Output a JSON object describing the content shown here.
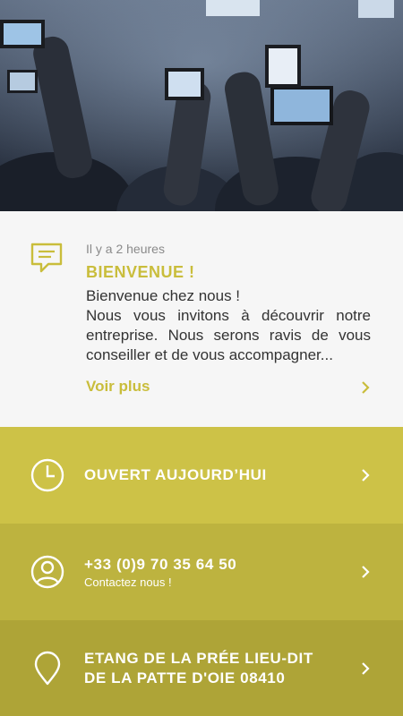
{
  "news": {
    "time": "Il y a 2 heures",
    "title": "BIENVENUE !",
    "body_line1": "Bienvenue chez nous !",
    "body_line2": "Nous vous invitons à découvrir notre entreprise. Nous serons ravis de vous conseiller et de vous accompagner...",
    "more_label": "Voir plus",
    "icon": "message-icon"
  },
  "hours": {
    "title": "OUVERT AUJOURD’HUI",
    "icon": "clock-icon"
  },
  "phone": {
    "number": "+33 (0)9 70 35 64 50",
    "sub": "Contactez nous !",
    "icon": "user-icon"
  },
  "address": {
    "line1": "ETANG DE LA PRÉE LIEU-DIT",
    "line2": "DE LA PATTE D'OIE 08410",
    "icon": "location-pin-icon"
  },
  "colors": {
    "accent": "#c9bd3b",
    "row1": "#cdc247",
    "row2": "#bdb33f",
    "row3": "#aea437"
  }
}
